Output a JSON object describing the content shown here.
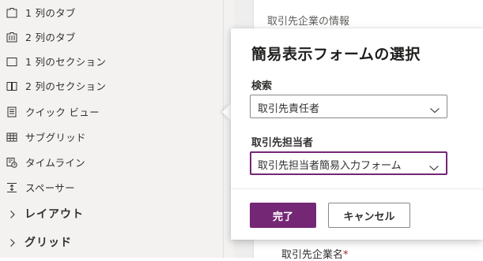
{
  "components": {
    "items": [
      {
        "label": "1 列のタブ",
        "icon": "one-column-tab-icon"
      },
      {
        "label": "2 列のタブ",
        "icon": "two-column-tab-icon"
      },
      {
        "label": "1 列のセクション",
        "icon": "one-column-section-icon"
      },
      {
        "label": "2 列のセクション",
        "icon": "two-column-section-icon"
      },
      {
        "label": "クイック ビュー",
        "icon": "quick-view-icon"
      },
      {
        "label": "サブグリッド",
        "icon": "subgrid-icon"
      },
      {
        "label": "タイムライン",
        "icon": "timeline-icon"
      },
      {
        "label": "スペーサー",
        "icon": "spacer-icon"
      }
    ],
    "groups": [
      {
        "label": "レイアウト"
      },
      {
        "label": "グリッド"
      }
    ]
  },
  "canvas": {
    "section_heading": "取引先企業の情報",
    "field_label": "取引先企業名",
    "required_marker": "*"
  },
  "dialog": {
    "title": "簡易表示フォームの選択",
    "search_label": "検索",
    "search_value": "取引先責任者",
    "form_label": "取引先担当者",
    "form_value": "取引先担当者簡易入力フォーム",
    "done_label": "完了",
    "cancel_label": "キャンセル"
  },
  "colors": {
    "accent": "#742774",
    "panel_bg": "#f3f2f1"
  }
}
